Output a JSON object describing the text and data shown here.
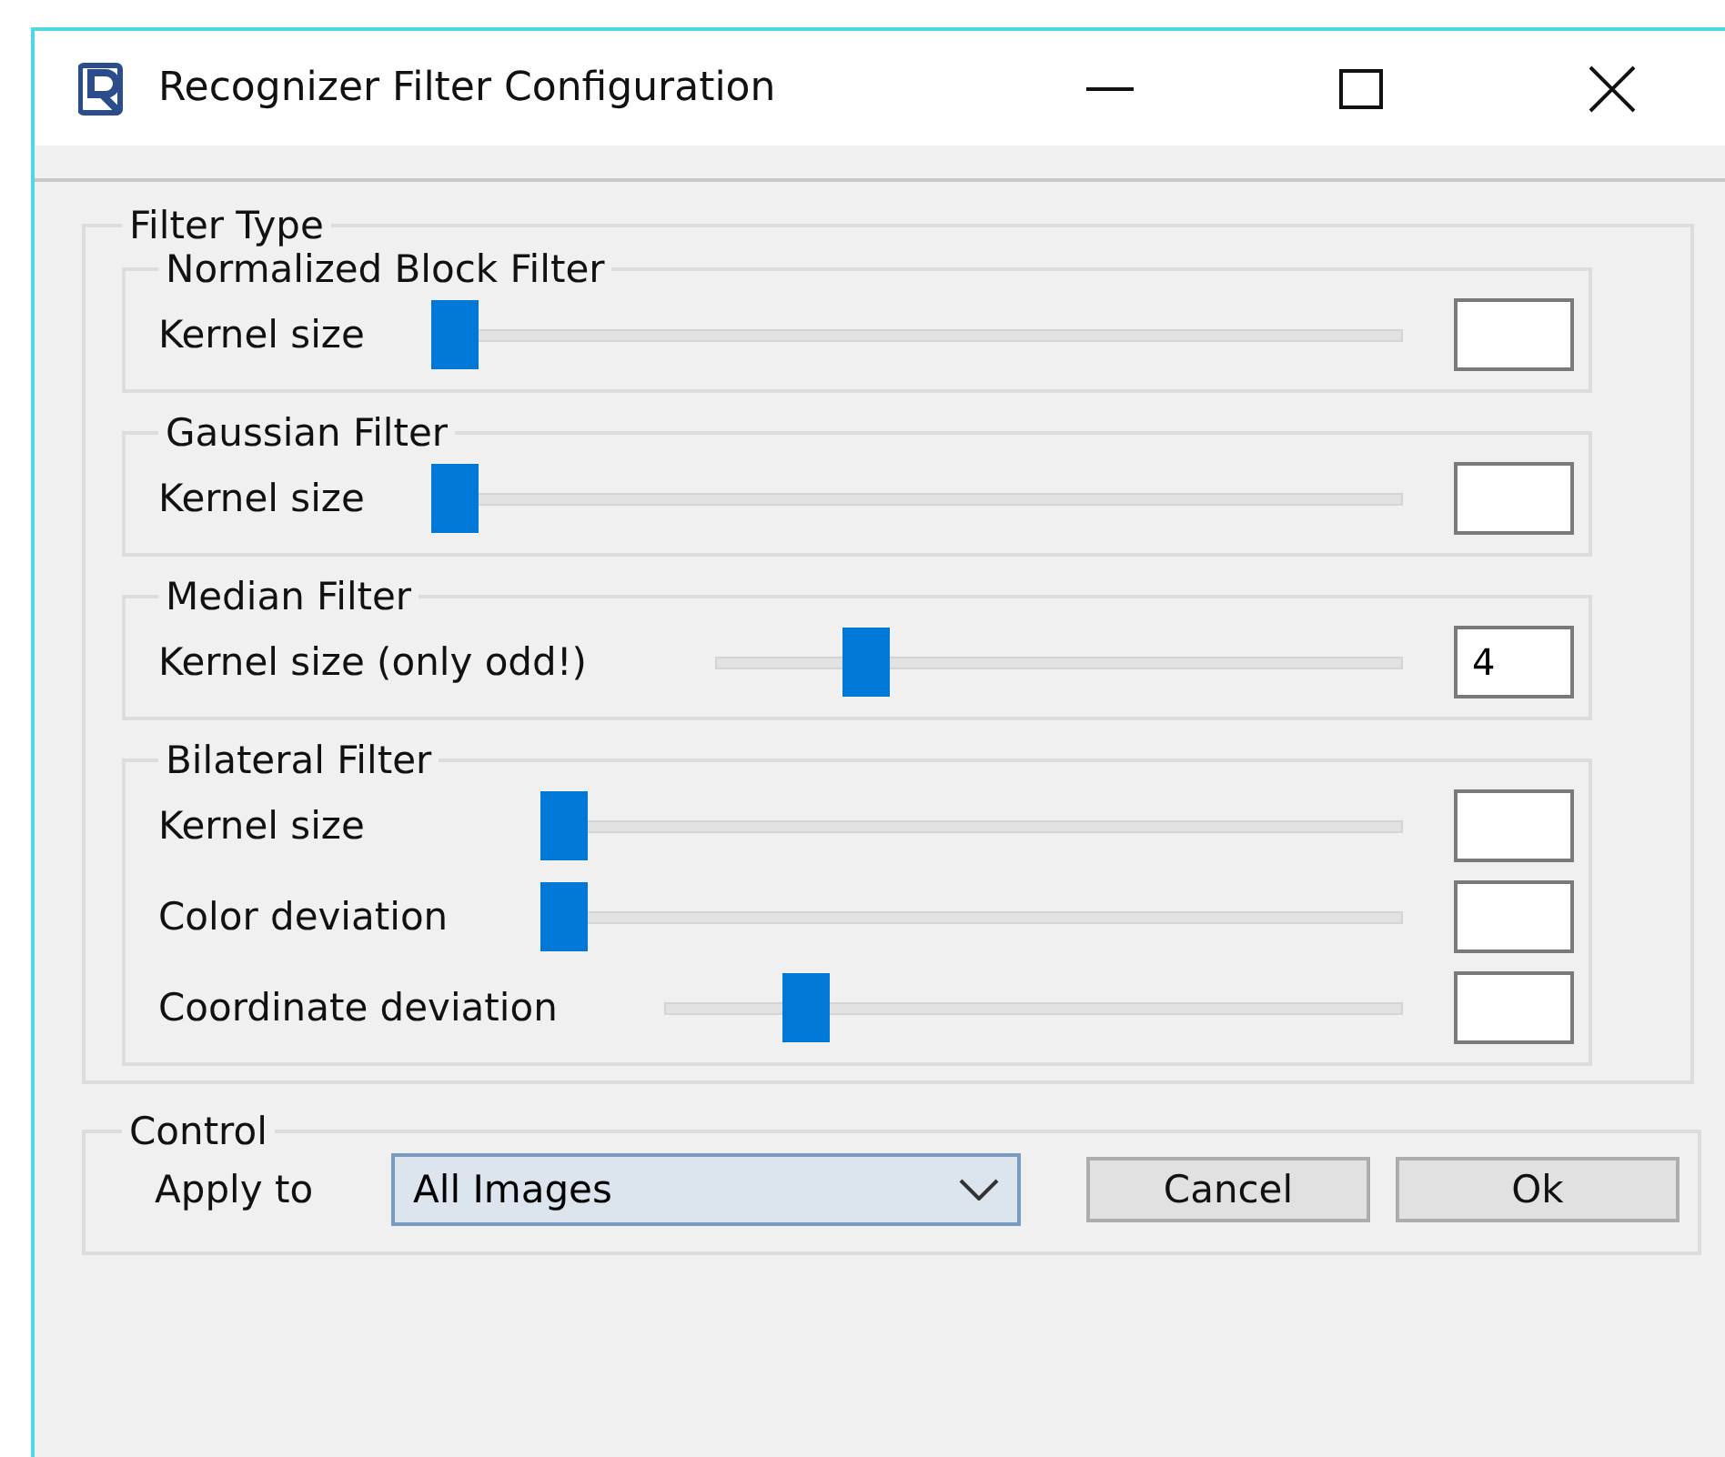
{
  "window": {
    "title": "Recognizer Filter Configuration"
  },
  "filter_type": {
    "title": "Filter Type",
    "groups": [
      {
        "title": "Normalized Block Filter",
        "rows": [
          {
            "label": "Kernel size",
            "level": 0,
            "value": ""
          }
        ]
      },
      {
        "title": "Gaussian Filter",
        "rows": [
          {
            "label": "Kernel size",
            "level": 0,
            "value": ""
          }
        ]
      },
      {
        "title": "Median Filter",
        "rows": [
          {
            "label": "Kernel size (only odd!)",
            "level": 0.2,
            "value": "4"
          }
        ]
      },
      {
        "title": "Bilateral Filter",
        "rows": [
          {
            "label": "Kernel size",
            "level": 0,
            "value": ""
          },
          {
            "label": "Color deviation",
            "level": 0,
            "value": ""
          },
          {
            "label": "Coordinate deviation",
            "level": 0.17,
            "value": ""
          }
        ]
      }
    ]
  },
  "control": {
    "title": "Control",
    "apply_label": "Apply to",
    "apply_value": "All Images",
    "buttons": [
      "Cancel",
      "Ok"
    ]
  }
}
